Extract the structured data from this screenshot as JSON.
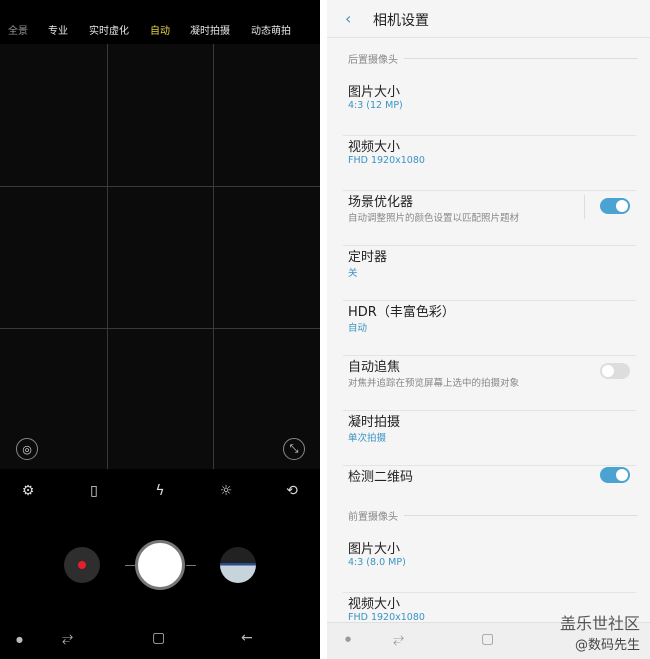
{
  "camera": {
    "modes": [
      "全景",
      "专业",
      "实时虚化",
      "自动",
      "凝时拍摄",
      "动态萌拍"
    ],
    "active_mode": "自动",
    "active_color": "#e8d84a",
    "tools": [
      "settings-icon",
      "aspect-ratio-icon",
      "flash-off-icon",
      "effects-icon",
      "switch-camera-icon"
    ]
  },
  "settings": {
    "back": "‹",
    "title": "相机设置",
    "rear_section": "后置摄像头",
    "rear": [
      {
        "title": "图片大小",
        "value": "4:3 (12 MP)"
      },
      {
        "title": "视频大小",
        "value": "FHD 1920x1080"
      },
      {
        "title": "场景优化器",
        "desc": "自动调整照片的颜色设置以匹配照片题材",
        "toggle": true
      },
      {
        "title": "定时器",
        "value": "关"
      },
      {
        "title": "HDR（丰富色彩）",
        "value": "自动"
      },
      {
        "title": "自动追焦",
        "desc": "对焦并追踪在预览屏幕上选中的拍摄对象",
        "toggle": false
      },
      {
        "title": "凝时拍摄",
        "value": "单次拍摄"
      },
      {
        "title": "检测二维码",
        "toggle": true
      }
    ],
    "front_section": "前置摄像头",
    "front": [
      {
        "title": "图片大小",
        "value": "4:3 (8.0 MP)"
      },
      {
        "title": "视频大小",
        "value": "FHD 1920x1080"
      }
    ],
    "accent": "#4aa3d1"
  },
  "watermark": {
    "line1": "盖乐世社区",
    "line2": "@数码先生"
  }
}
